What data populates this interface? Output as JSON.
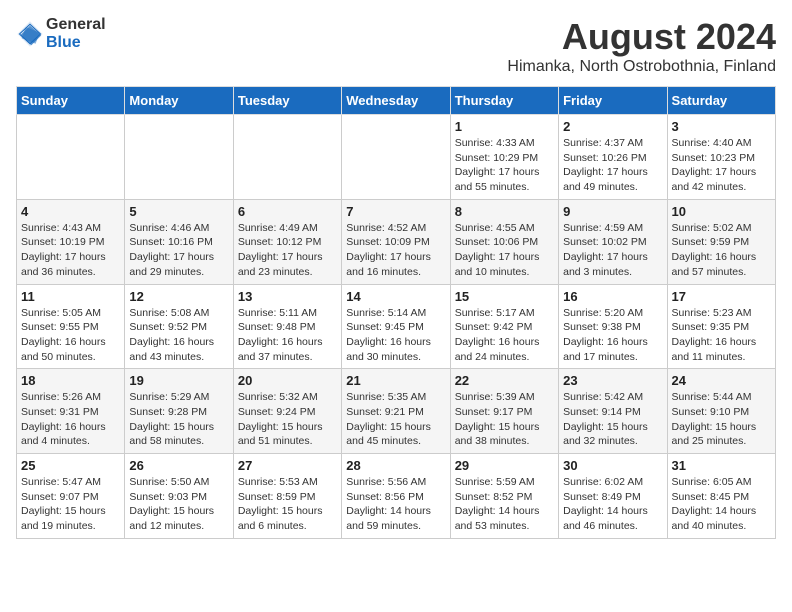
{
  "logo": {
    "general": "General",
    "blue": "Blue"
  },
  "title": "August 2024",
  "subtitle": "Himanka, North Ostrobothnia, Finland",
  "days_of_week": [
    "Sunday",
    "Monday",
    "Tuesday",
    "Wednesday",
    "Thursday",
    "Friday",
    "Saturday"
  ],
  "weeks": [
    [
      {
        "day": "",
        "info": ""
      },
      {
        "day": "",
        "info": ""
      },
      {
        "day": "",
        "info": ""
      },
      {
        "day": "",
        "info": ""
      },
      {
        "day": "1",
        "info": "Sunrise: 4:33 AM\nSunset: 10:29 PM\nDaylight: 17 hours\nand 55 minutes."
      },
      {
        "day": "2",
        "info": "Sunrise: 4:37 AM\nSunset: 10:26 PM\nDaylight: 17 hours\nand 49 minutes."
      },
      {
        "day": "3",
        "info": "Sunrise: 4:40 AM\nSunset: 10:23 PM\nDaylight: 17 hours\nand 42 minutes."
      }
    ],
    [
      {
        "day": "4",
        "info": "Sunrise: 4:43 AM\nSunset: 10:19 PM\nDaylight: 17 hours\nand 36 minutes."
      },
      {
        "day": "5",
        "info": "Sunrise: 4:46 AM\nSunset: 10:16 PM\nDaylight: 17 hours\nand 29 minutes."
      },
      {
        "day": "6",
        "info": "Sunrise: 4:49 AM\nSunset: 10:12 PM\nDaylight: 17 hours\nand 23 minutes."
      },
      {
        "day": "7",
        "info": "Sunrise: 4:52 AM\nSunset: 10:09 PM\nDaylight: 17 hours\nand 16 minutes."
      },
      {
        "day": "8",
        "info": "Sunrise: 4:55 AM\nSunset: 10:06 PM\nDaylight: 17 hours\nand 10 minutes."
      },
      {
        "day": "9",
        "info": "Sunrise: 4:59 AM\nSunset: 10:02 PM\nDaylight: 17 hours\nand 3 minutes."
      },
      {
        "day": "10",
        "info": "Sunrise: 5:02 AM\nSunset: 9:59 PM\nDaylight: 16 hours\nand 57 minutes."
      }
    ],
    [
      {
        "day": "11",
        "info": "Sunrise: 5:05 AM\nSunset: 9:55 PM\nDaylight: 16 hours\nand 50 minutes."
      },
      {
        "day": "12",
        "info": "Sunrise: 5:08 AM\nSunset: 9:52 PM\nDaylight: 16 hours\nand 43 minutes."
      },
      {
        "day": "13",
        "info": "Sunrise: 5:11 AM\nSunset: 9:48 PM\nDaylight: 16 hours\nand 37 minutes."
      },
      {
        "day": "14",
        "info": "Sunrise: 5:14 AM\nSunset: 9:45 PM\nDaylight: 16 hours\nand 30 minutes."
      },
      {
        "day": "15",
        "info": "Sunrise: 5:17 AM\nSunset: 9:42 PM\nDaylight: 16 hours\nand 24 minutes."
      },
      {
        "day": "16",
        "info": "Sunrise: 5:20 AM\nSunset: 9:38 PM\nDaylight: 16 hours\nand 17 minutes."
      },
      {
        "day": "17",
        "info": "Sunrise: 5:23 AM\nSunset: 9:35 PM\nDaylight: 16 hours\nand 11 minutes."
      }
    ],
    [
      {
        "day": "18",
        "info": "Sunrise: 5:26 AM\nSunset: 9:31 PM\nDaylight: 16 hours\nand 4 minutes."
      },
      {
        "day": "19",
        "info": "Sunrise: 5:29 AM\nSunset: 9:28 PM\nDaylight: 15 hours\nand 58 minutes."
      },
      {
        "day": "20",
        "info": "Sunrise: 5:32 AM\nSunset: 9:24 PM\nDaylight: 15 hours\nand 51 minutes."
      },
      {
        "day": "21",
        "info": "Sunrise: 5:35 AM\nSunset: 9:21 PM\nDaylight: 15 hours\nand 45 minutes."
      },
      {
        "day": "22",
        "info": "Sunrise: 5:39 AM\nSunset: 9:17 PM\nDaylight: 15 hours\nand 38 minutes."
      },
      {
        "day": "23",
        "info": "Sunrise: 5:42 AM\nSunset: 9:14 PM\nDaylight: 15 hours\nand 32 minutes."
      },
      {
        "day": "24",
        "info": "Sunrise: 5:44 AM\nSunset: 9:10 PM\nDaylight: 15 hours\nand 25 minutes."
      }
    ],
    [
      {
        "day": "25",
        "info": "Sunrise: 5:47 AM\nSunset: 9:07 PM\nDaylight: 15 hours\nand 19 minutes."
      },
      {
        "day": "26",
        "info": "Sunrise: 5:50 AM\nSunset: 9:03 PM\nDaylight: 15 hours\nand 12 minutes."
      },
      {
        "day": "27",
        "info": "Sunrise: 5:53 AM\nSunset: 8:59 PM\nDaylight: 15 hours\nand 6 minutes."
      },
      {
        "day": "28",
        "info": "Sunrise: 5:56 AM\nSunset: 8:56 PM\nDaylight: 14 hours\nand 59 minutes."
      },
      {
        "day": "29",
        "info": "Sunrise: 5:59 AM\nSunset: 8:52 PM\nDaylight: 14 hours\nand 53 minutes."
      },
      {
        "day": "30",
        "info": "Sunrise: 6:02 AM\nSunset: 8:49 PM\nDaylight: 14 hours\nand 46 minutes."
      },
      {
        "day": "31",
        "info": "Sunrise: 6:05 AM\nSunset: 8:45 PM\nDaylight: 14 hours\nand 40 minutes."
      }
    ]
  ]
}
